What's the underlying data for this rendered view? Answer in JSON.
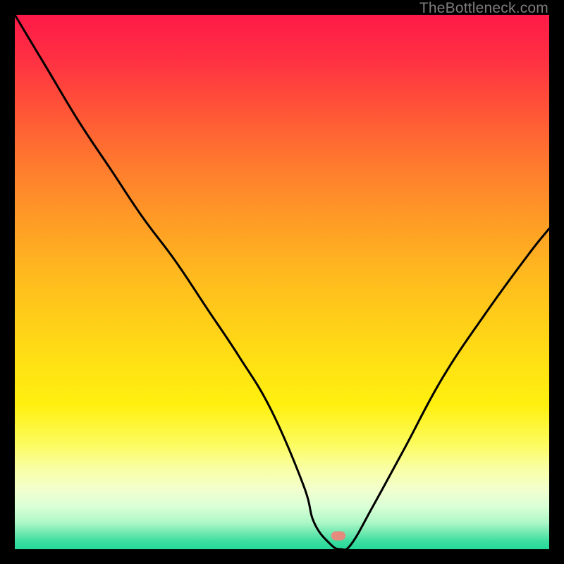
{
  "watermark": "TheBottleneck.com",
  "marker": {
    "x_frac": 0.605,
    "y_frac": 0.975,
    "color": "#e58a7d"
  },
  "chart_data": {
    "type": "line",
    "title": "",
    "xlabel": "",
    "ylabel": "",
    "xlim": [
      0,
      100
    ],
    "ylim": [
      0,
      100
    ],
    "grid": false,
    "legend": false,
    "annotations": [],
    "series": [
      {
        "name": "curve",
        "x": [
          0,
          6,
          12,
          18,
          24,
          30,
          36,
          42,
          48,
          54,
          56,
          59,
          61,
          63,
          67,
          73,
          80,
          88,
          96,
          100
        ],
        "y": [
          100,
          90,
          80,
          71,
          62,
          54,
          45,
          36,
          26,
          12,
          5,
          1,
          0,
          1,
          8,
          19,
          32,
          44,
          55,
          60
        ]
      }
    ],
    "background_gradient": {
      "direction": "vertical",
      "stops": [
        {
          "pos": 0.0,
          "color": "#ff1a48"
        },
        {
          "pos": 0.18,
          "color": "#ff5537"
        },
        {
          "pos": 0.38,
          "color": "#ff9a26"
        },
        {
          "pos": 0.58,
          "color": "#ffd018"
        },
        {
          "pos": 0.73,
          "color": "#fff00f"
        },
        {
          "pos": 0.85,
          "color": "#f9ffa5"
        },
        {
          "pos": 0.92,
          "color": "#daffd6"
        },
        {
          "pos": 1.0,
          "color": "#25d998"
        }
      ]
    }
  }
}
